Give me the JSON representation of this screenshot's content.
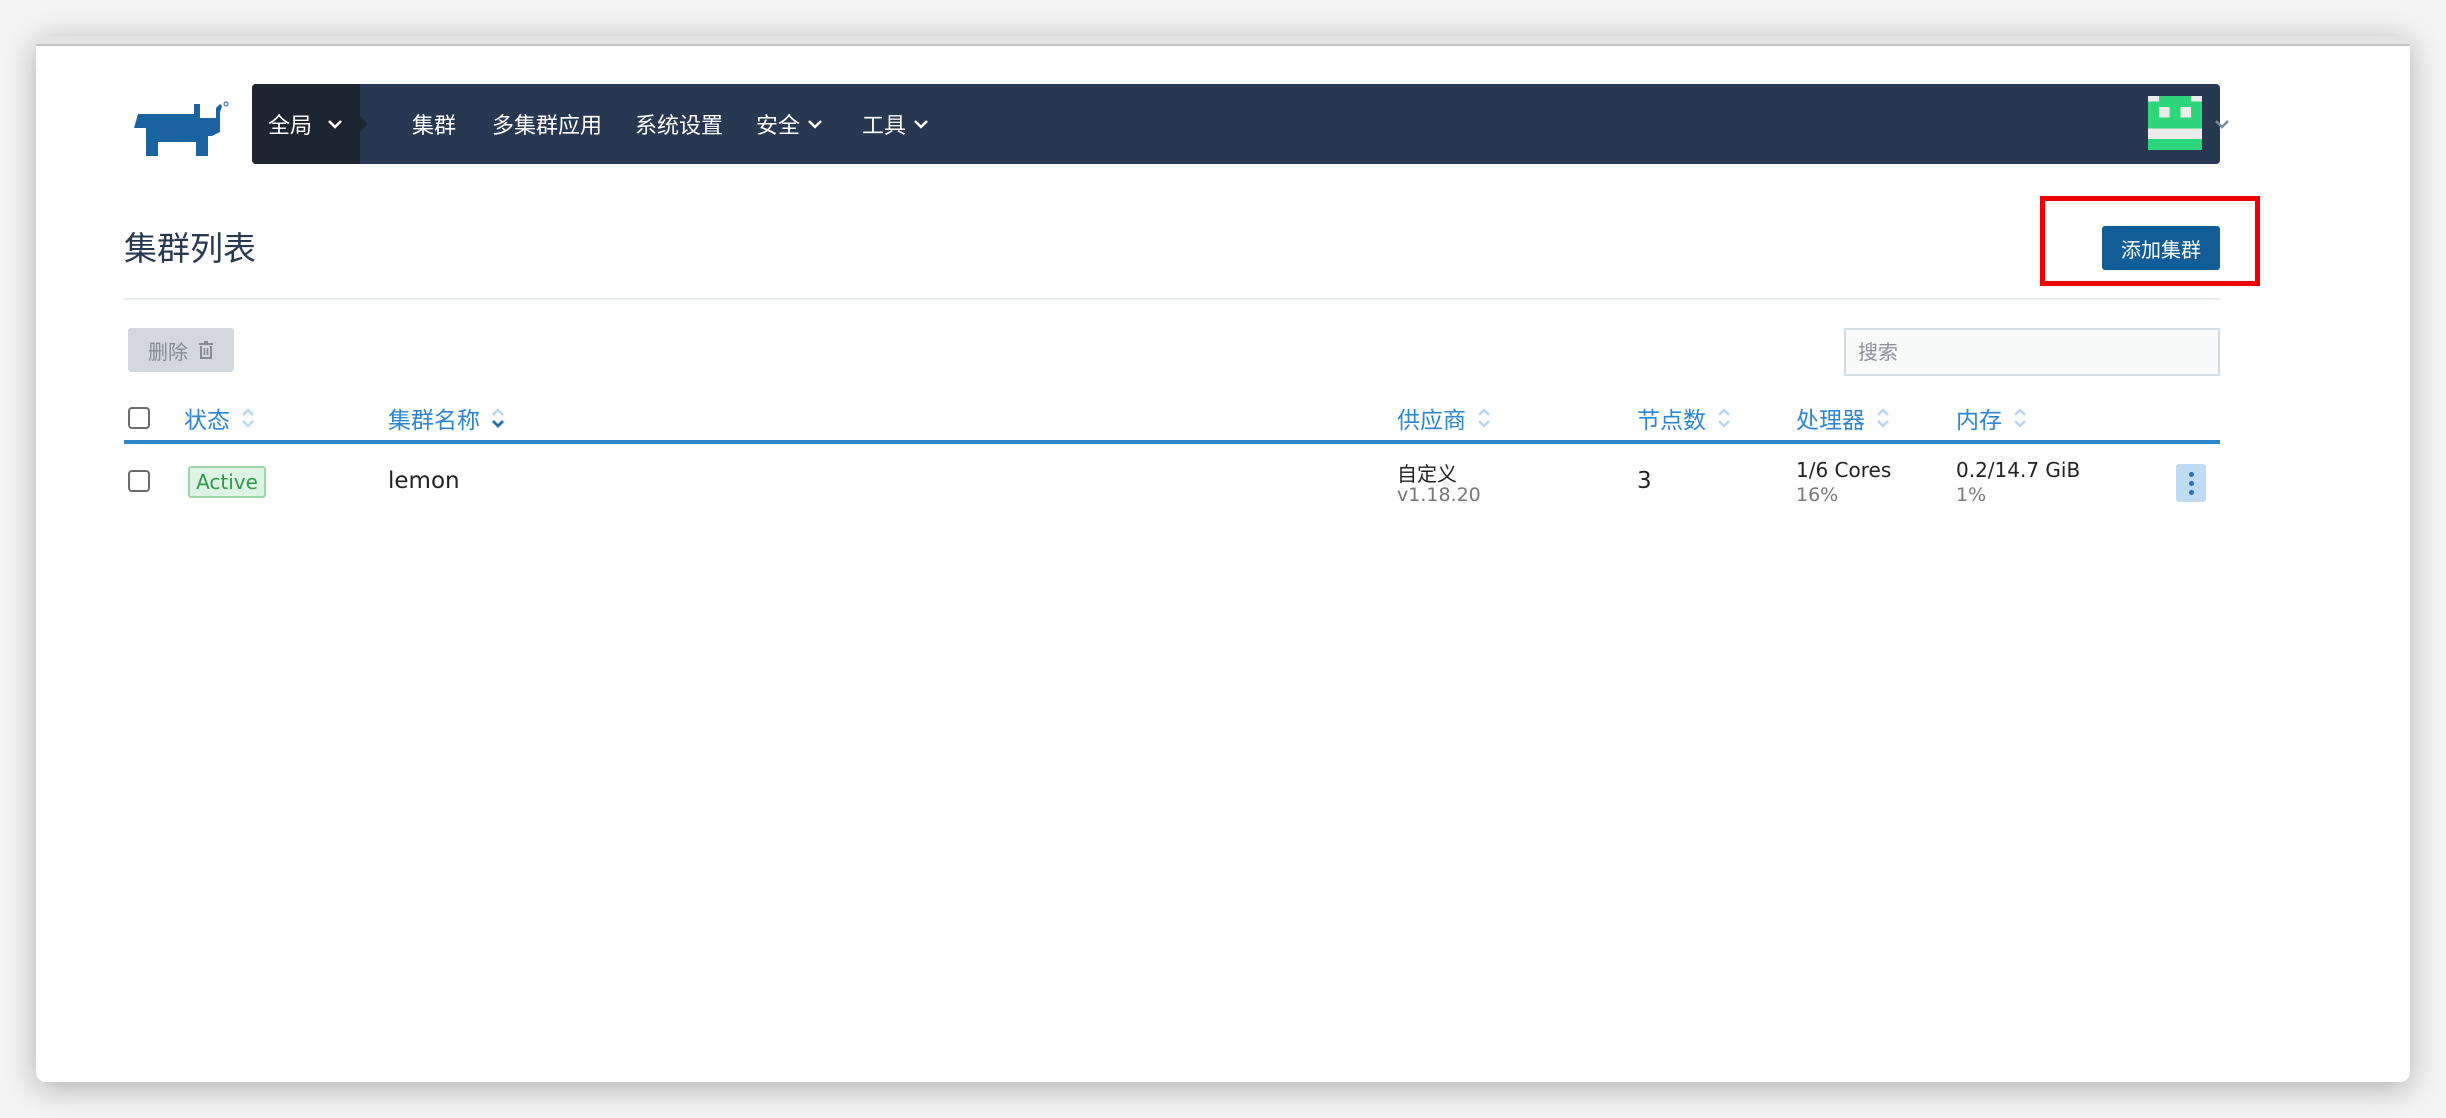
{
  "nav": {
    "scope_label": "全局",
    "items": [
      {
        "label": "集群",
        "has_dropdown": false
      },
      {
        "label": "多集群应用",
        "has_dropdown": false
      },
      {
        "label": "系统设置",
        "has_dropdown": false
      },
      {
        "label": "安全",
        "has_dropdown": true
      },
      {
        "label": "工具",
        "has_dropdown": true
      }
    ],
    "avatar_icon": "user-avatar-identicon"
  },
  "page": {
    "title": "集群列表",
    "add_button_label": "添加集群",
    "highlight_color": "#ee0000"
  },
  "toolbar": {
    "delete_label": "删除",
    "delete_icon": "trash-icon",
    "search_placeholder": "搜索"
  },
  "table": {
    "columns": [
      "状态",
      "集群名称",
      "供应商",
      "节点数",
      "处理器",
      "内存"
    ],
    "rows": [
      {
        "state": "Active",
        "name": "lemon",
        "provider": "自定义",
        "provider_version": "v1.18.20",
        "nodes": "3",
        "cpu": "1/6 Cores",
        "cpu_pct": "16%",
        "memory": "0.2/14.7 GiB",
        "memory_pct": "1%"
      }
    ]
  },
  "colors": {
    "nav_bg": "#283850",
    "accent": "#2d86d0",
    "primary_button": "#135d96",
    "active_badge": "#2c9b48"
  }
}
